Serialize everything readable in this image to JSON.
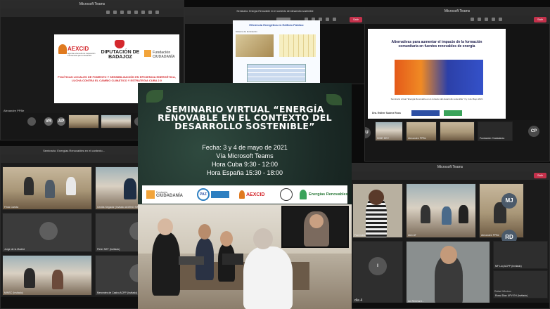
{
  "windows": {
    "top_left": {
      "title": "Microsoft Teams",
      "presenter_label": "Alexandre PPBe",
      "slide": {
        "logos": [
          "AEXCID",
          "DIPUTACIÓN DE BADAJOZ",
          "Fundación CIUDADANÍA"
        ],
        "aexcid_sub": "Agencia extremeña de cooperación internacional para el desarrollo",
        "policy_text": "POLÍTICAS LOCALES DE FOMENTO Y SENSIBILIZACIÓN EN EFICIENCIA ENERGÉTICA, LUCHA CONTRA EL CAMBIO CLIMÁTICO Y ESTRATEGIA CUBA 2.0"
      },
      "participants": [
        "VR",
        "AP"
      ]
    },
    "top_middle": {
      "title": "Seminario: Energía Renovable en el contexto del desarrollo sostenible",
      "leave_label": "Salir",
      "slide_title": "Eficiencia Energética en Edificio Público",
      "slide_sub": "Sistema de iluminación"
    },
    "top_right": {
      "title": "Microsoft Teams",
      "leave_label": "Salir",
      "slide_title": "Alternativas para aumentar el impacto de la formación comunitaria en fuentes renovables de energía",
      "slide_caption": "Seminario virtual \"Energía Renovable en el contexto del desarrollo sostenible\" 3 y 4 de Mayo 2021",
      "author": "Dra. Esther Suárez Roca",
      "participants": [
        "MU",
        "CP"
      ],
      "names": [
        "MINE DEV",
        "Alexandre PPBe",
        "Fundación Ciudadanía"
      ]
    },
    "bottom_left": {
      "title": "Seminario: Energías Renovables en el contexto...",
      "tiles": [
        {
          "label": "Frida Cuesta"
        },
        {
          "label": "Cecilia Segador (Invitado AGENO SIR...)"
        },
        {
          "label": "Jorge de la Madrid"
        },
        {
          "label": "Fleter NET (Invitado)"
        },
        {
          "label": "MINSC (Invitado)"
        },
        {
          "label": "Mercedes de Castro ACPP (Invitado)"
        }
      ]
    },
    "bottom_right": {
      "title": "Microsoft Teams",
      "leave_label": "Salir",
      "tiles": [
        {
          "label": "Fun Cuba"
        },
        {
          "label": "Alex AT"
        },
        {
          "label": "Alexandre PPBe"
        },
        {
          "label": "día 4"
        },
        {
          "label": "ian Reichard..."
        },
        {
          "label": "MF Liu) ACPP (Invitado)"
        },
        {
          "label": "Rossi Diaz UPV EH (Invitado)"
        }
      ],
      "avatars": [
        "MJ",
        "RD",
        "I"
      ],
      "notice": "Rafael Windsor"
    }
  },
  "poster": {
    "title": "SEMINARIO VIRTUAL “ENERGÍA RENOVABLE EN EL CONTEXTO DEL DESARROLLO SOSTENIBLE”",
    "date": "Fecha: 3 y 4 de mayo de 2021",
    "platform": "Vía Microsoft Teams",
    "time_cuba": "Hora Cuba 9:30 - 12:00",
    "time_spain": "Hora España 15:30 - 18:00",
    "logos": {
      "ciudadania": "CIUDADANÍA",
      "ciudadania_pre": "Fundación",
      "paz": "PAZ",
      "aexcid": "AEXCID",
      "energias": "Energías Renovables"
    }
  },
  "colors": {
    "teams_dark": "#1f1f1f",
    "leave_red": "#c4314b",
    "poster_green": "#1d2a26",
    "aexcid_orange": "#e07a1f",
    "badajoz_red": "#d4282d",
    "slide_blue": "#2d4fa3"
  }
}
